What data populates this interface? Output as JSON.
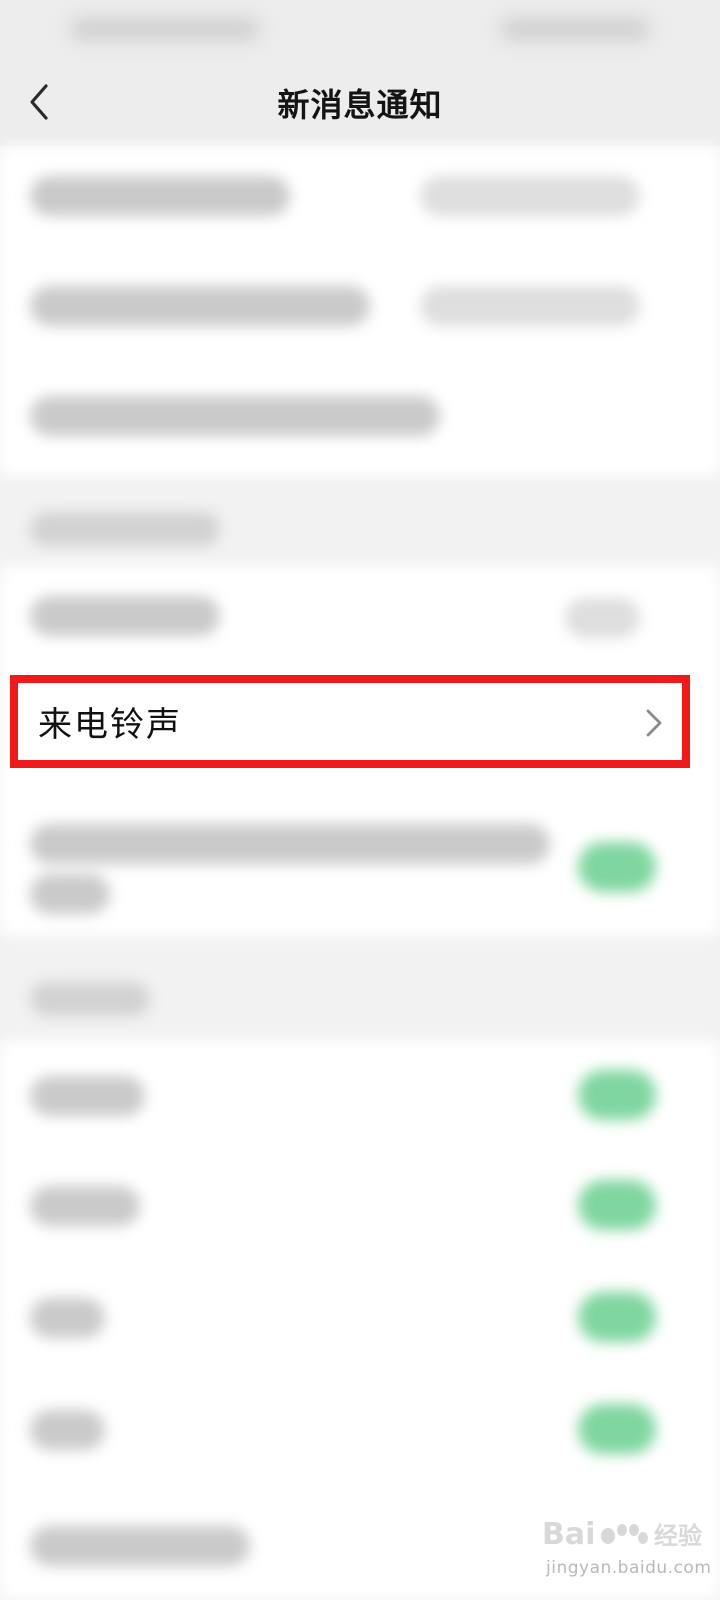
{
  "header": {
    "title": "新消息通知",
    "back_icon": "chevron-left-icon"
  },
  "ringtone_row": {
    "label": "来电铃声",
    "chevron_icon": "chevron-right-icon",
    "highlight_color": "#f11a1a"
  },
  "colors": {
    "page_background": "#f2f2f2",
    "card_background": "#ffffff",
    "toggle_on": "#7fd6a0"
  },
  "watermark": {
    "logo": "Baidu 经验",
    "url": "jingyan.baidu.com"
  }
}
